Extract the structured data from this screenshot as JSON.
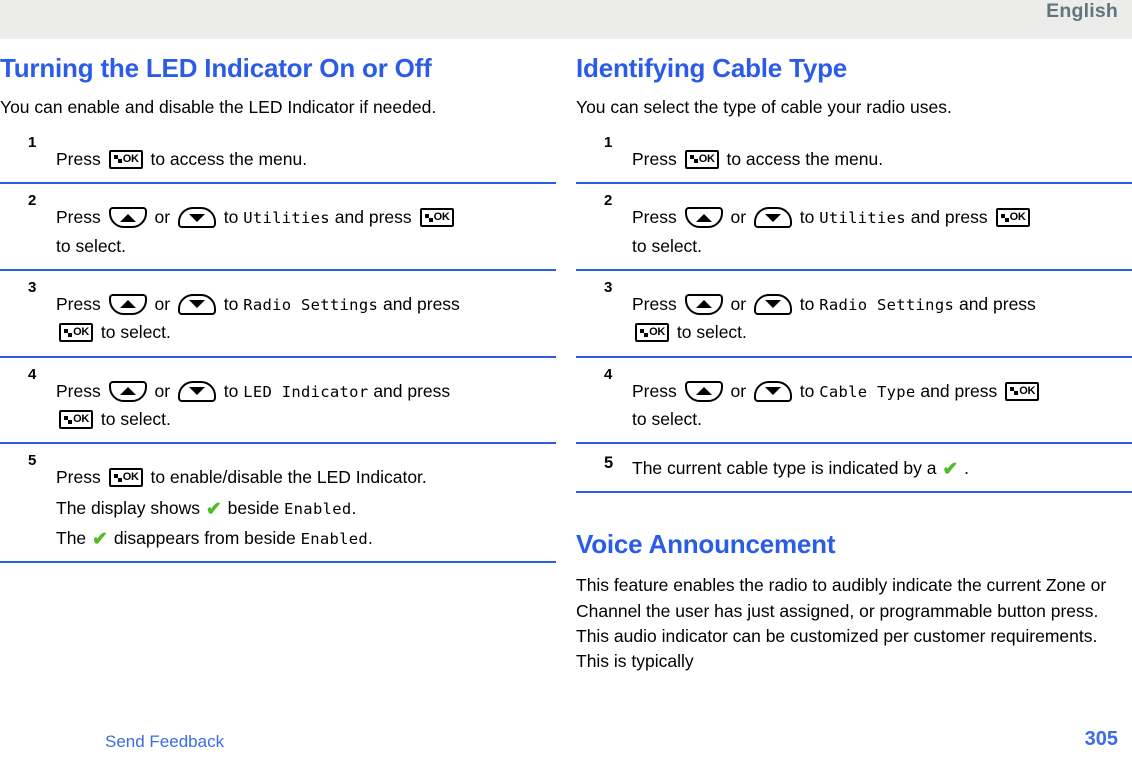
{
  "header": {
    "language": "English"
  },
  "icons": {
    "ok_label": "OK",
    "check": "✔"
  },
  "left_column": {
    "title": "Turning the LED Indicator On or Off",
    "intro": "You can enable and disable the LED Indicator if needed.",
    "steps": [
      {
        "number": "1",
        "layout": "stacked",
        "parts": [
          {
            "type": "text",
            "value": "Press "
          },
          {
            "type": "key",
            "key": "ok"
          },
          {
            "type": "text",
            "value": " to access the menu."
          }
        ]
      },
      {
        "number": "2",
        "layout": "stacked",
        "parts": [
          {
            "type": "text",
            "value": "Press "
          },
          {
            "type": "key",
            "key": "up"
          },
          {
            "type": "text",
            "value": " or "
          },
          {
            "type": "key",
            "key": "down"
          },
          {
            "type": "text",
            "value": " to "
          },
          {
            "type": "mono",
            "value": "Utilities"
          },
          {
            "type": "text",
            "value": " and press "
          },
          {
            "type": "key",
            "key": "ok"
          },
          {
            "type": "break"
          },
          {
            "type": "text",
            "value": "to select."
          }
        ]
      },
      {
        "number": "3",
        "layout": "stacked",
        "parts": [
          {
            "type": "text",
            "value": "Press "
          },
          {
            "type": "key",
            "key": "up"
          },
          {
            "type": "text",
            "value": " or "
          },
          {
            "type": "key",
            "key": "down"
          },
          {
            "type": "text",
            "value": " to "
          },
          {
            "type": "mono",
            "value": "Radio Settings"
          },
          {
            "type": "text",
            "value": " and press "
          },
          {
            "type": "break"
          },
          {
            "type": "key",
            "key": "ok"
          },
          {
            "type": "text",
            "value": " to select."
          }
        ]
      },
      {
        "number": "4",
        "layout": "stacked",
        "parts": [
          {
            "type": "text",
            "value": "Press "
          },
          {
            "type": "key",
            "key": "up"
          },
          {
            "type": "text",
            "value": " or "
          },
          {
            "type": "key",
            "key": "down"
          },
          {
            "type": "text",
            "value": " to "
          },
          {
            "type": "mono",
            "value": "LED Indicator"
          },
          {
            "type": "text",
            "value": " and press "
          },
          {
            "type": "break"
          },
          {
            "type": "key",
            "key": "ok"
          },
          {
            "type": "text",
            "value": " to select."
          }
        ]
      },
      {
        "number": "5",
        "layout": "stacked",
        "parts": [
          {
            "type": "text",
            "value": "Press "
          },
          {
            "type": "key",
            "key": "ok"
          },
          {
            "type": "text",
            "value": " to enable/disable the LED Indicator."
          }
        ],
        "sub_lines": [
          [
            {
              "type": "text",
              "value": "The display shows "
            },
            {
              "type": "check"
            },
            {
              "type": "text",
              "value": " beside "
            },
            {
              "type": "mono",
              "value": "Enabled"
            },
            {
              "type": "text",
              "value": "."
            }
          ],
          [
            {
              "type": "text",
              "value": "The "
            },
            {
              "type": "check"
            },
            {
              "type": "text",
              "value": " disappears from beside "
            },
            {
              "type": "mono",
              "value": "Enabled"
            },
            {
              "type": "text",
              "value": "."
            }
          ]
        ]
      }
    ]
  },
  "right_column": {
    "title": "Identifying Cable Type",
    "intro": "You can select the type of cable your radio uses.",
    "steps": [
      {
        "number": "1",
        "layout": "stacked",
        "parts": [
          {
            "type": "text",
            "value": "Press "
          },
          {
            "type": "key",
            "key": "ok"
          },
          {
            "type": "text",
            "value": " to access the menu."
          }
        ]
      },
      {
        "number": "2",
        "layout": "stacked",
        "parts": [
          {
            "type": "text",
            "value": "Press "
          },
          {
            "type": "key",
            "key": "up"
          },
          {
            "type": "text",
            "value": " or "
          },
          {
            "type": "key",
            "key": "down"
          },
          {
            "type": "text",
            "value": " to "
          },
          {
            "type": "mono",
            "value": "Utilities"
          },
          {
            "type": "text",
            "value": " and press "
          },
          {
            "type": "key",
            "key": "ok"
          },
          {
            "type": "break"
          },
          {
            "type": "text",
            "value": "to select."
          }
        ]
      },
      {
        "number": "3",
        "layout": "stacked",
        "parts": [
          {
            "type": "text",
            "value": "Press "
          },
          {
            "type": "key",
            "key": "up"
          },
          {
            "type": "text",
            "value": " or "
          },
          {
            "type": "key",
            "key": "down"
          },
          {
            "type": "text",
            "value": " to "
          },
          {
            "type": "mono",
            "value": "Radio Settings"
          },
          {
            "type": "text",
            "value": " and press "
          },
          {
            "type": "break"
          },
          {
            "type": "key",
            "key": "ok"
          },
          {
            "type": "text",
            "value": " to select."
          }
        ]
      },
      {
        "number": "4",
        "layout": "stacked",
        "parts": [
          {
            "type": "text",
            "value": "Press "
          },
          {
            "type": "key",
            "key": "up"
          },
          {
            "type": "text",
            "value": " or "
          },
          {
            "type": "key",
            "key": "down"
          },
          {
            "type": "text",
            "value": " to "
          },
          {
            "type": "mono",
            "value": "Cable Type"
          },
          {
            "type": "text",
            "value": " and press "
          },
          {
            "type": "key",
            "key": "ok"
          },
          {
            "type": "break"
          },
          {
            "type": "text",
            "value": "to select."
          }
        ]
      },
      {
        "number": "5",
        "layout": "inline",
        "parts": [
          {
            "type": "text",
            "value": "The current cable type is indicated by a "
          },
          {
            "type": "check"
          },
          {
            "type": "text",
            "value": " ."
          }
        ]
      }
    ],
    "second_title": "Voice Announcement",
    "second_body": "This feature enables the radio to audibly indicate the current Zone or Channel the user has just assigned, or programmable button press. This audio indicator can be customized per customer requirements. This is typically"
  },
  "footer": {
    "send_feedback": "Send Feedback",
    "page_number": "305"
  },
  "colors": {
    "heading_blue": "#2B5CE8",
    "link_blue": "#3A6BE8",
    "rule_blue": "#2B5CE8",
    "header_band": "#ECECEA",
    "language_gray": "#62757C",
    "check_green": "#55BB22"
  }
}
